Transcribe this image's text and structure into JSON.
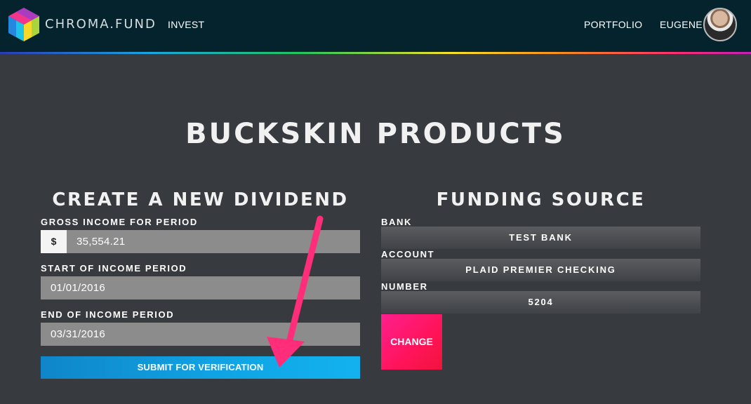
{
  "header": {
    "brand": "CHROMA.FUND",
    "nav_invest": "INVEST",
    "nav_portfolio": "PORTFOLIO",
    "user_name": "EUGENE"
  },
  "page": {
    "title": "BUCKSKIN PRODUCTS"
  },
  "dividend_form": {
    "title": "CREATE A NEW DIVIDEND",
    "gross_income_label": "GROSS INCOME FOR PERIOD",
    "currency_symbol": "$",
    "gross_income_value": "35,554.21",
    "start_label": "START OF INCOME PERIOD",
    "start_value": "01/01/2016",
    "end_label": "END OF INCOME PERIOD",
    "end_value": "03/31/2016",
    "submit_label": "SUBMIT FOR VERIFICATION"
  },
  "funding_source": {
    "title": "FUNDING SOURCE",
    "bank_label": "BANK",
    "bank_value": "TEST BANK",
    "account_label": "ACCOUNT",
    "account_value": "PLAID PREMIER CHECKING",
    "number_label": "NUMBER",
    "number_value": "5204",
    "change_label": "CHANGE"
  },
  "colors": {
    "header_bg": "#04232c",
    "page_bg": "#373a3f",
    "submit_blue": "#10a3e3",
    "change_pink": "#ff1459",
    "annotation_arrow": "#ff2d7a"
  },
  "icons": {
    "logo": "chroma-cube-logo",
    "avatar": "user-avatar"
  }
}
